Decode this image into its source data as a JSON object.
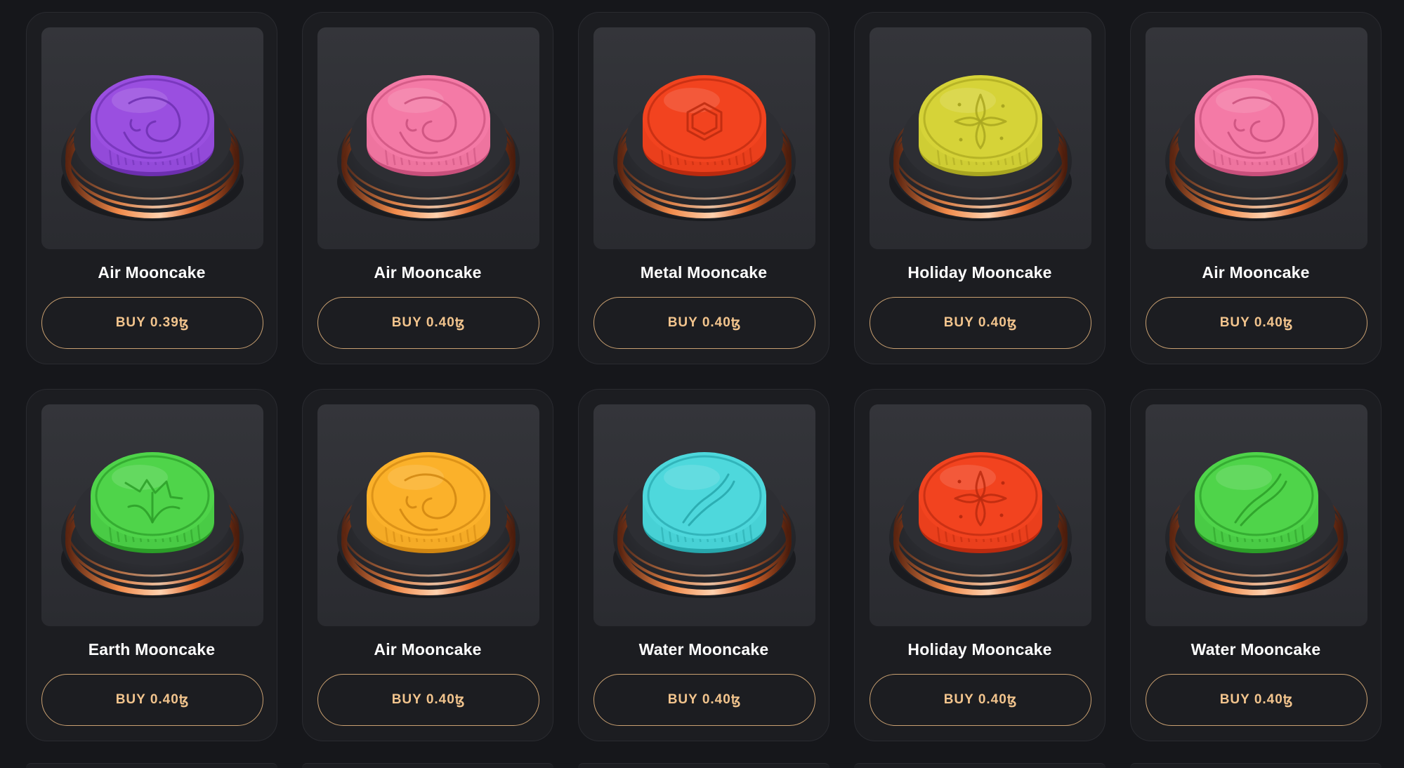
{
  "products": [
    {
      "name": "Air Mooncake",
      "buy_label": "BUY",
      "price": "0.39",
      "currency": "ꜩ",
      "color": "#9a4fe0",
      "dark": "#6d2fb0",
      "pattern": "air-swirl"
    },
    {
      "name": "Air Mooncake",
      "buy_label": "BUY",
      "price": "0.40",
      "currency": "ꜩ",
      "color": "#f47aa6",
      "dark": "#c9507c",
      "pattern": "air-swirl"
    },
    {
      "name": "Metal Mooncake",
      "buy_label": "BUY",
      "price": "0.40",
      "currency": "ꜩ",
      "color": "#f2431f",
      "dark": "#bb2a0f",
      "pattern": "metal-hexagon"
    },
    {
      "name": "Holiday Mooncake",
      "buy_label": "BUY",
      "price": "0.40",
      "currency": "ꜩ",
      "color": "#d6d338",
      "dark": "#a9a620",
      "pattern": "holiday-flower"
    },
    {
      "name": "Air Mooncake",
      "buy_label": "BUY",
      "price": "0.40",
      "currency": "ꜩ",
      "color": "#f47aa6",
      "dark": "#c9507c",
      "pattern": "air-swirl"
    },
    {
      "name": "Earth Mooncake",
      "buy_label": "BUY",
      "price": "0.40",
      "currency": "ꜩ",
      "color": "#4fd44a",
      "dark": "#2b9d28",
      "pattern": "earth-leaf"
    },
    {
      "name": "Air Mooncake",
      "buy_label": "BUY",
      "price": "0.40",
      "currency": "ꜩ",
      "color": "#fbb12a",
      "dark": "#d08611",
      "pattern": "air-swirl"
    },
    {
      "name": "Water Mooncake",
      "buy_label": "BUY",
      "price": "0.40",
      "currency": "ꜩ",
      "color": "#4ed8dc",
      "dark": "#27a7ac",
      "pattern": "water-wave"
    },
    {
      "name": "Holiday Mooncake",
      "buy_label": "BUY",
      "price": "0.40",
      "currency": "ꜩ",
      "color": "#f2431f",
      "dark": "#bb2a0f",
      "pattern": "holiday-flower"
    },
    {
      "name": "Water Mooncake",
      "buy_label": "BUY",
      "price": "0.40",
      "currency": "ꜩ",
      "color": "#4fd44a",
      "dark": "#2b9d28",
      "pattern": "water-wave"
    }
  ],
  "colors": {
    "page_background": "#16171b",
    "card_background": "#1c1d21",
    "button_border": "#c9a071",
    "button_text": "#f2c48d",
    "ring_copper": "#e06a2c"
  }
}
